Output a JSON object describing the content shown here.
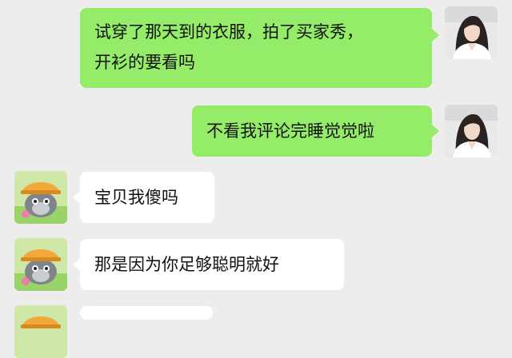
{
  "messages": [
    {
      "sender": "me",
      "avatar": "girl-avatar",
      "text_line1": "试穿了那天到的衣服，拍了买家秀，",
      "text_line2": "开衫的要看吗"
    },
    {
      "sender": "me",
      "avatar": "girl-avatar",
      "text": "不看我评论完睡觉觉啦"
    },
    {
      "sender": "other",
      "avatar": "grey-wolf-avatar",
      "text": "宝贝我傻吗"
    },
    {
      "sender": "other",
      "avatar": "grey-wolf-avatar",
      "text": "那是因为你足够聪明就好"
    },
    {
      "sender": "other",
      "avatar": "grey-wolf-avatar",
      "text": ""
    }
  ],
  "colors": {
    "background": "#ededed",
    "outgoing_bubble": "#95ec69",
    "incoming_bubble": "#ffffff"
  }
}
